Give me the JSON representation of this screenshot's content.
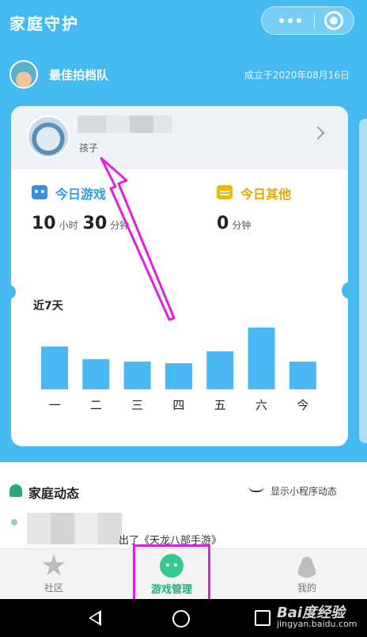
{
  "header": {
    "title": "家庭守护"
  },
  "group": {
    "name": "最佳拍档队",
    "established": "成立于2020年08月16日"
  },
  "card": {
    "child_role": "孩子",
    "stats": {
      "game": {
        "label": "今日游戏",
        "hours": "10",
        "hours_unit": "小时",
        "minutes": "30",
        "minutes_unit": "分钟"
      },
      "other": {
        "label": "今日其他",
        "minutes": "0",
        "minutes_unit": "分钟"
      }
    },
    "week_title": "近7天"
  },
  "chart_data": {
    "type": "bar",
    "title": "近7天",
    "categories": [
      "一",
      "二",
      "三",
      "四",
      "五",
      "六",
      "今"
    ],
    "values": [
      54,
      38,
      35,
      33,
      48,
      78,
      35
    ],
    "ylim": [
      0,
      90
    ],
    "grid": false,
    "color": "#4ab8f2"
  },
  "feed": {
    "title": "家庭动态",
    "toggle_label": "显示小程序动态",
    "item_text": "出了《天龙八部手游》"
  },
  "tabs": [
    {
      "label": "社区",
      "icon": "star-icon"
    },
    {
      "label": "游戏管理",
      "icon": "game-controller-icon",
      "active": true
    },
    {
      "label": "我的",
      "icon": "person-icon"
    }
  ],
  "watermark": {
    "brand": "Bai度经验",
    "url": "jingyan.baidu.com"
  },
  "colors": {
    "primary": "#45baf0",
    "bar": "#4ab8f2",
    "active_tab": "#1fb27a",
    "other_accent": "#e8a500",
    "annotation": "#e020e0"
  }
}
